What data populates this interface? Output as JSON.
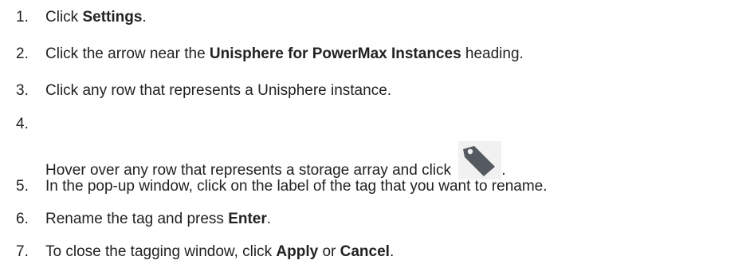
{
  "steps": [
    {
      "number": "1.",
      "pre": "Click ",
      "bold1": "Settings",
      "post": "."
    },
    {
      "number": "2.",
      "pre": "Click the arrow near the ",
      "bold1": "Unisphere for PowerMax Instances",
      "post": " heading."
    },
    {
      "number": "3.",
      "text": "Click any row that represents a Unisphere instance."
    },
    {
      "number": "4.",
      "pre": "Hover over any row that represents a storage array and click ",
      "icon": "tag-icon",
      "post": "."
    },
    {
      "number": "5.",
      "text": "In the pop-up window, click on the label of the tag that you want to rename."
    },
    {
      "number": "6.",
      "pre": "Rename the tag and press ",
      "bold1": "Enter",
      "post": "."
    },
    {
      "number": "7.",
      "pre": "To close the tagging window, click ",
      "bold1": "Apply",
      "mid": " or ",
      "bold2": "Cancel",
      "post": "."
    }
  ]
}
